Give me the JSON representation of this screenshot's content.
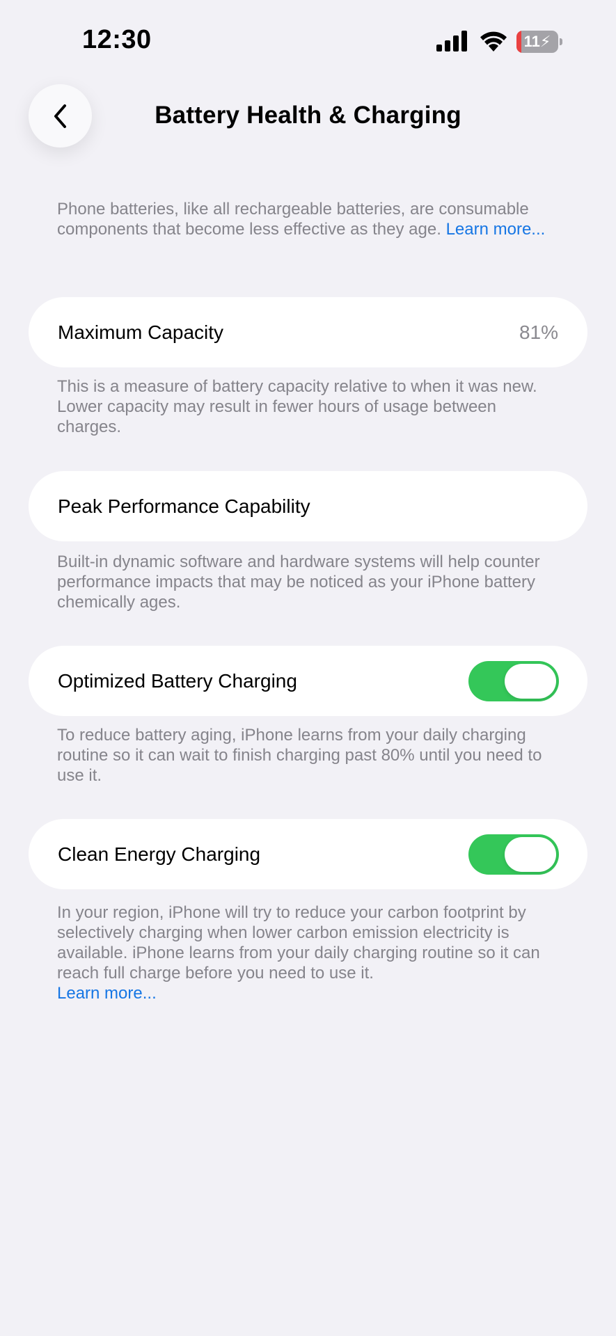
{
  "status_bar": {
    "time": "12:30",
    "battery_level": "11",
    "battery_fraction": 0.11,
    "battery_low_color": "#ea4141",
    "icons": [
      "signal-icon",
      "wifi-icon",
      "battery-charging-icon"
    ]
  },
  "nav": {
    "title": "Battery Health & Charging",
    "back_icon": "chevron-left-icon"
  },
  "intro": {
    "text": "Phone batteries, like all rechargeable batteries, are consumable components that become less effective as they age. ",
    "link": "Learn more..."
  },
  "max_capacity": {
    "label": "Maximum Capacity",
    "value": "81%",
    "footnote": "This is a measure of battery capacity relative to when it was new. Lower capacity may result in fewer hours of usage between charges."
  },
  "peak_performance": {
    "label": "Peak Performance Capability",
    "footnote": "Built-in dynamic software and hardware systems will help counter performance impacts that may be noticed as your iPhone battery chemically ages."
  },
  "optimized_charging": {
    "label": "Optimized Battery Charging",
    "enabled": true,
    "footnote": "To reduce battery aging, iPhone learns from your daily charging routine so it can wait to finish charging past 80% until you need to use it."
  },
  "clean_energy": {
    "label": "Clean Energy Charging",
    "enabled": true,
    "footnote": "In your region, iPhone will try to reduce your carbon footprint by selectively charging when lower carbon emission electricity is available. iPhone learns from your daily charging routine so it can reach full charge before you need to use it.",
    "link": "Learn more..."
  },
  "colors": {
    "background": "#f2f1f6",
    "card": "#ffffff",
    "toggle_on": "#34c759",
    "link": "#1676e4",
    "secondary_text": "#85848b"
  }
}
